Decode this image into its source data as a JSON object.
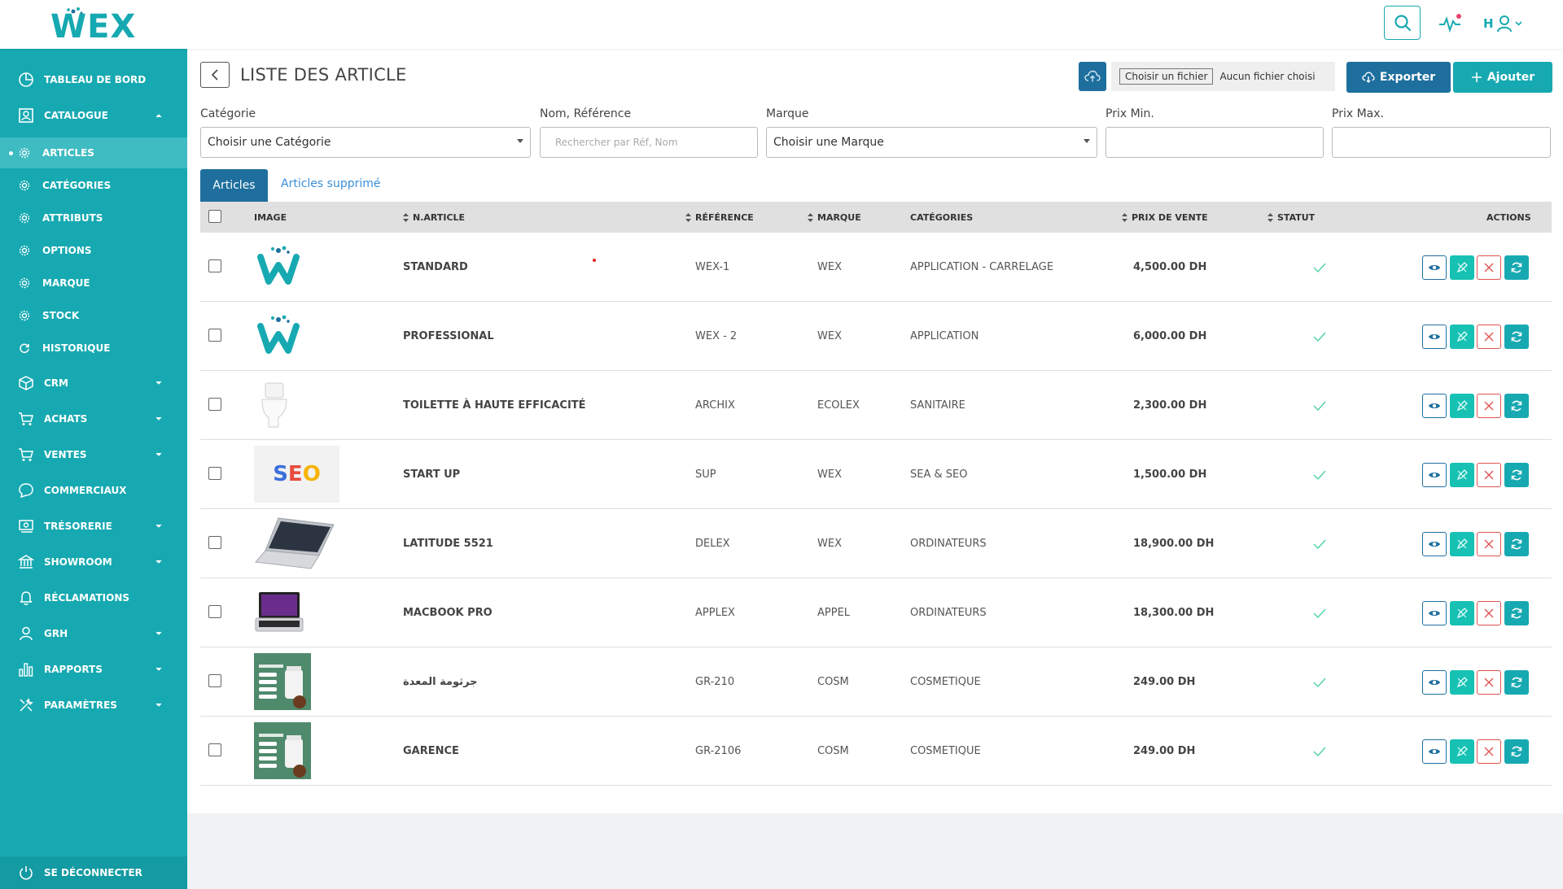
{
  "app": {
    "logo_text": "WEX",
    "brand_color": "#17a9b1",
    "user_initial": "H"
  },
  "sidebar": {
    "items": [
      {
        "label": "TABLEAU DE BORD",
        "icon": "pie-chart-icon"
      },
      {
        "label": "CATALOGUE",
        "icon": "catalogue-icon",
        "expanded": true
      },
      {
        "label": "CRM",
        "icon": "cube-icon"
      },
      {
        "label": "ACHATS",
        "icon": "cart-icon"
      },
      {
        "label": "VENTES",
        "icon": "cart-icon"
      },
      {
        "label": "COMMERCIAUX",
        "icon": "chat-icon"
      },
      {
        "label": "TRÉSORERIE",
        "icon": "money-icon"
      },
      {
        "label": "SHOWROOM",
        "icon": "bank-icon"
      },
      {
        "label": "RÉCLAMATIONS",
        "icon": "bell-icon"
      },
      {
        "label": "GRH",
        "icon": "user-icon"
      },
      {
        "label": "RAPPORTS",
        "icon": "bar-chart-icon"
      },
      {
        "label": "PARAMÈTRES",
        "icon": "tools-icon"
      }
    ],
    "catalogue_sub": [
      {
        "label": "ARTICLES",
        "active": true
      },
      {
        "label": "CATÉGORIES"
      },
      {
        "label": "ATTRIBUTS"
      },
      {
        "label": "OPTIONS"
      },
      {
        "label": "MARQUE"
      },
      {
        "label": "STOCK"
      },
      {
        "label": "HISTORIQUE"
      }
    ],
    "logout_label": "SE DÉCONNECTER"
  },
  "page": {
    "title": "LISTE DES ARTICLE",
    "file_button": "Choisir un fichier",
    "file_status": "Aucun fichier choisi",
    "export_label": "Exporter",
    "add_label": "Ajouter"
  },
  "filters": {
    "category_label": "Catégorie",
    "category_value": "Choisir une Catégorie",
    "search_label": "Nom, Référence",
    "search_placeholder": "Rechercher par Réf, Nom",
    "brand_label": "Marque",
    "brand_value": "Choisir une Marque",
    "price_min_label": "Prix Min.",
    "price_max_label": "Prix Max."
  },
  "tabs": {
    "active": "Articles",
    "deleted": "Articles supprimé"
  },
  "table": {
    "columns": {
      "image": "IMAGE",
      "name": "N.ARTICLE",
      "reference": "RÉFÉRENCE",
      "brand": "MARQUE",
      "categories": "CATÉGORIES",
      "price": "PRIX DE VENTE",
      "status": "STATUT",
      "actions": "ACTIONS"
    },
    "rows": [
      {
        "name": "STANDARD",
        "reference": "WEX-1",
        "brand": "WEX",
        "categories": "APPLICATION - CARRELAGE",
        "price": "4,500.00 DH",
        "image": "wex-logo"
      },
      {
        "name": "PROFESSIONAL",
        "reference": "WEX - 2",
        "brand": "WEX",
        "categories": "APPLICATION",
        "price": "6,000.00 DH",
        "image": "wex-logo"
      },
      {
        "name": "TOILETTE À HAUTE EFFICACITÉ",
        "reference": "ARCHIX",
        "brand": "ECOLEX",
        "categories": "SANITAIRE",
        "price": "2,300.00 DH",
        "image": "toilet"
      },
      {
        "name": "START UP",
        "reference": "SUP",
        "brand": "WEX",
        "categories": "SEA & SEO",
        "price": "1,500.00 DH",
        "image": "seo",
        "image_text": "SEO"
      },
      {
        "name": "LATITUDE 5521",
        "reference": "DELEX",
        "brand": "WEX",
        "categories": "ORDINATEURS",
        "price": "18,900.00 DH",
        "image": "laptop"
      },
      {
        "name": "MACBOOK PRO",
        "reference": "APPLEX",
        "brand": "APPEL",
        "categories": "ORDINATEURS",
        "price": "18,300.00 DH",
        "image": "macbook"
      },
      {
        "name": "جرثومة المعدة",
        "reference": "GR-210",
        "brand": "COSM",
        "categories": "COSMETIQUE",
        "price": "249.00 DH",
        "image": "cosmetic"
      },
      {
        "name": "GARENCE",
        "reference": "GR-2106",
        "brand": "COSM",
        "categories": "COSMETIQUE",
        "price": "249.00 DH",
        "image": "cosmetic"
      }
    ]
  }
}
